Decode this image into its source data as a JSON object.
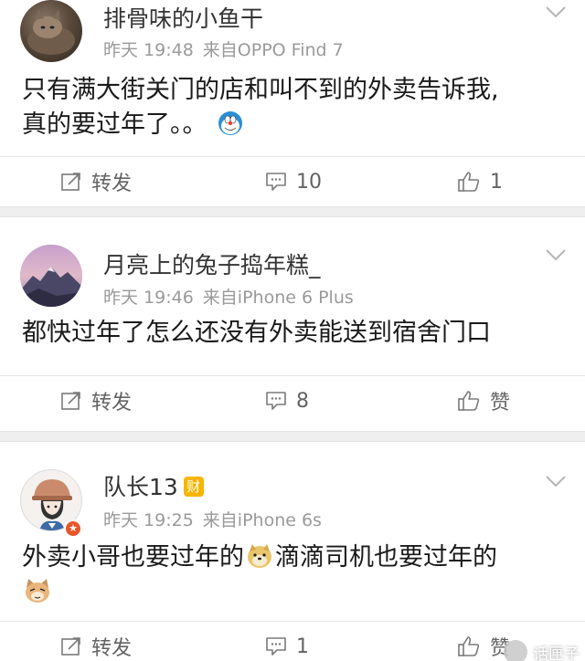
{
  "posts": [
    {
      "username": "排骨味的小鱼干",
      "time": "昨天 19:48",
      "source": "来自OPPO Find 7",
      "content_line1": "只有满大街关门的店和叫不到的外卖告诉我,",
      "content_line2": "真的要过年了。。",
      "emoji": "doraemon-face",
      "repost_label": "转发",
      "comment_count": "10",
      "like_label": "1"
    },
    {
      "username": "月亮上的兔子捣年糕_",
      "time": "昨天 19:46",
      "source": "来自iPhone 6 Plus",
      "content_line1": "都快过年了怎么还没有外卖能送到宿舍门口",
      "repost_label": "转发",
      "comment_count": "8",
      "like_label": "赞"
    },
    {
      "username": "队长13",
      "badge": "财",
      "time": "昨天 19:25",
      "source": "来自iPhone 6s",
      "content_part1": "外卖小哥也要过年的",
      "content_part2": "滴滴司机也要过年的",
      "emoji1": "doge-face",
      "emoji2": "cat-face",
      "repost_label": "转发",
      "comment_count": "1",
      "like_label": "赞"
    }
  ],
  "watermark": "话匣子",
  "colors": {
    "text_primary": "#1a1a1a",
    "text_meta": "#9a9a9a",
    "action_gray": "#636363",
    "separator": "#efefef",
    "badge_gold": "#f7b500",
    "verified_orange": "#e8562a"
  }
}
